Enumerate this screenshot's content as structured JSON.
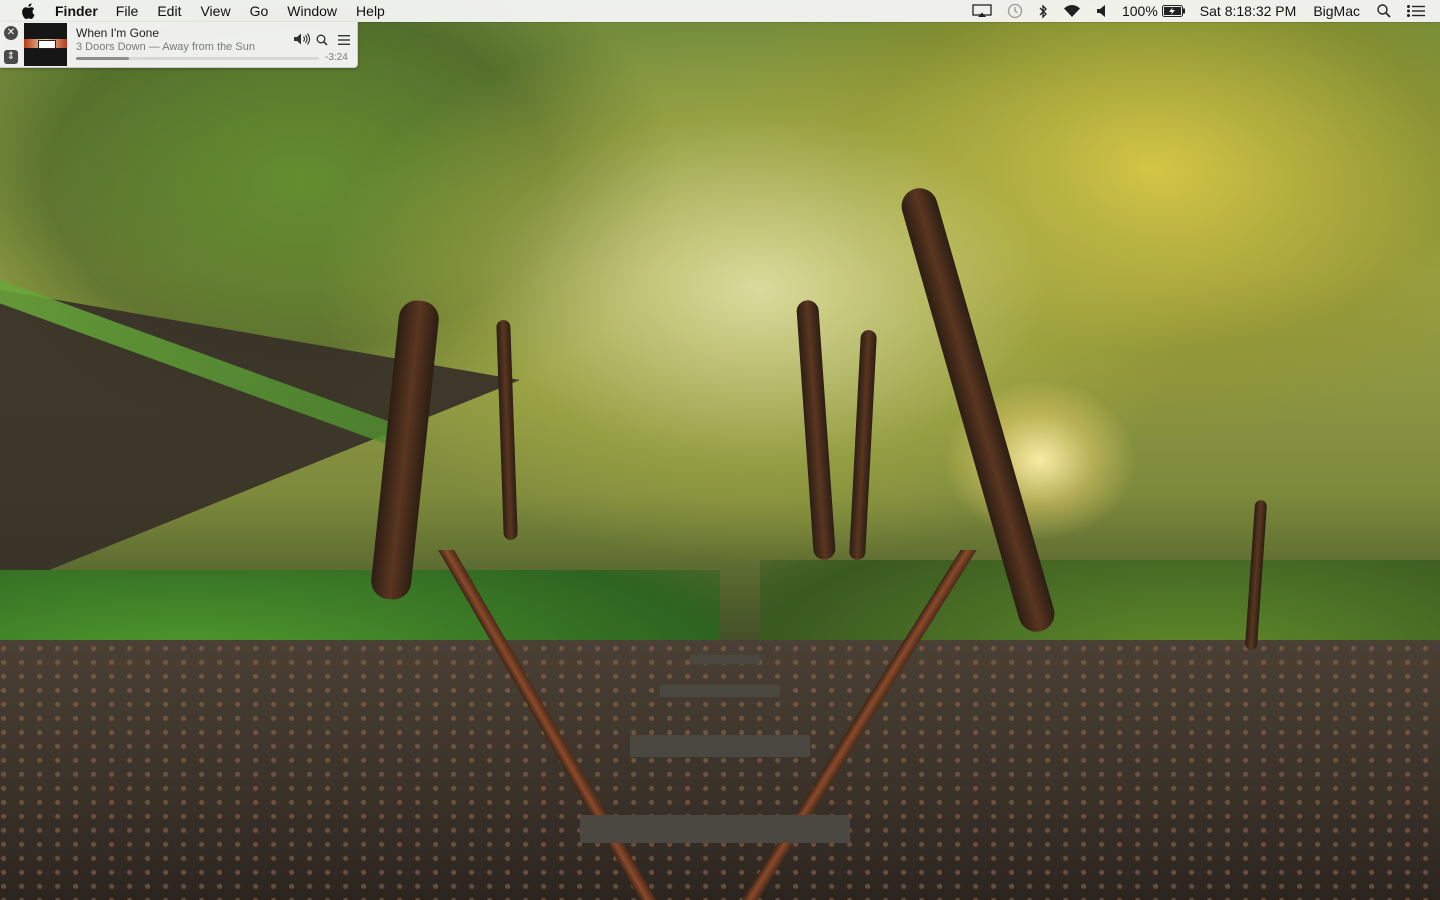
{
  "menubar": {
    "app_name": "Finder",
    "menus": [
      "File",
      "Edit",
      "View",
      "Go",
      "Window",
      "Help"
    ],
    "battery_percent": "100%",
    "clock": "Sat 8:18:32 PM",
    "user": "BigMac",
    "icons": [
      "apple-icon",
      "airplay-icon",
      "time-machine-icon",
      "bluetooth-icon",
      "wifi-icon",
      "volume-icon",
      "battery-charging-icon",
      "spotlight-icon",
      "notification-center-icon"
    ]
  },
  "mini_player": {
    "track_title": "When I'm Gone",
    "track_subtitle": "3 Doors Down — Away from the Sun",
    "time_remaining": "-3:24",
    "progress_fraction": 0.22,
    "icons": [
      "close-icon",
      "expand-icon",
      "volume-icon",
      "search-icon",
      "up-next-list-icon"
    ]
  },
  "colors": {
    "menubar_bg": "#f6f6f6",
    "player_bg": "#f4f4f4",
    "progress_fill": "#8e8e8e"
  }
}
